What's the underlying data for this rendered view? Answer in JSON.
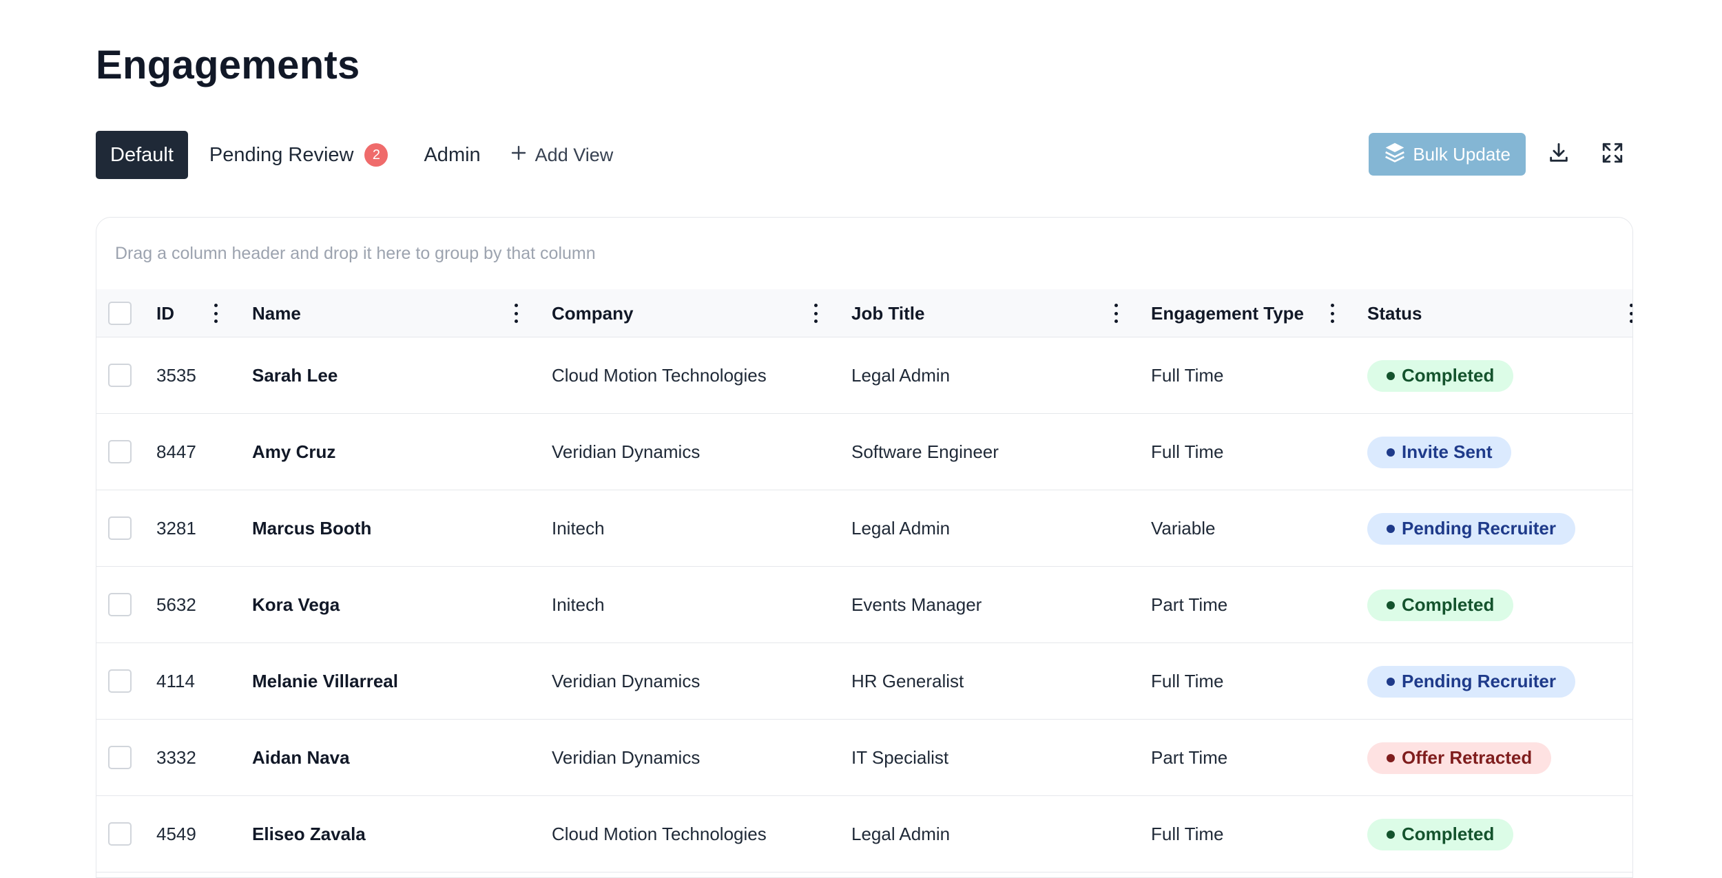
{
  "page": {
    "title": "Engagements"
  },
  "tabs": [
    {
      "label": "Default",
      "active": true
    },
    {
      "label": "Pending Review",
      "badge": "2",
      "active": false
    },
    {
      "label": "Admin",
      "active": false
    }
  ],
  "add_view": {
    "label": "Add View"
  },
  "toolbar": {
    "bulk_update_label": "Bulk Update"
  },
  "grid": {
    "group_panel_text": "Drag a column header and drop it here to group by that column",
    "columns": [
      "ID",
      "Name",
      "Company",
      "Job Title",
      "Engagement Type",
      "Status"
    ],
    "rows": [
      {
        "id": "3535",
        "name": "Sarah Lee",
        "company": "Cloud Motion Technologies",
        "job_title": "Legal Admin",
        "type": "Full Time",
        "status": "Completed",
        "status_kind": "completed"
      },
      {
        "id": "8447",
        "name": "Amy Cruz",
        "company": "Veridian Dynamics",
        "job_title": "Software Engineer",
        "type": "Full Time",
        "status": "Invite Sent",
        "status_kind": "blue"
      },
      {
        "id": "3281",
        "name": "Marcus Booth",
        "company": "Initech",
        "job_title": "Legal Admin",
        "type": "Variable",
        "status": "Pending Recruiter",
        "status_kind": "blue"
      },
      {
        "id": "5632",
        "name": "Kora Vega",
        "company": "Initech",
        "job_title": "Events Manager",
        "type": "Part Time",
        "status": "Completed",
        "status_kind": "completed"
      },
      {
        "id": "4114",
        "name": "Melanie Villarreal",
        "company": "Veridian Dynamics",
        "job_title": "HR Generalist",
        "type": "Full Time",
        "status": "Pending Recruiter",
        "status_kind": "blue"
      },
      {
        "id": "3332",
        "name": "Aidan Nava",
        "company": "Veridian Dynamics",
        "job_title": "IT Specialist",
        "type": "Part Time",
        "status": "Offer Retracted",
        "status_kind": "red"
      },
      {
        "id": "4549",
        "name": "Eliseo Zavala",
        "company": "Cloud Motion Technologies",
        "job_title": "Legal Admin",
        "type": "Full Time",
        "status": "Completed",
        "status_kind": "completed"
      }
    ]
  },
  "colors": {
    "active_tab_bg": "#1f2937",
    "badge": "#ef6b6b",
    "bulk_button": "#84b6d4",
    "completed_bg": "#dcfce7",
    "blue_bg": "#dbeafe",
    "red_bg": "#fee2e2"
  },
  "icons": [
    "plus-icon",
    "layers-icon",
    "download-icon",
    "expand-icon",
    "kebab-menu-icon",
    "status-dot-icon"
  ]
}
